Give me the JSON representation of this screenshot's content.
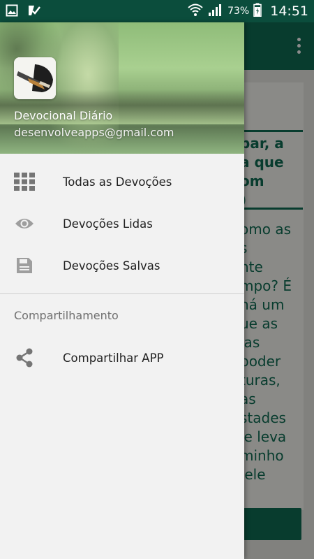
{
  "status_bar": {
    "battery_percent": "73%",
    "time": "14:51",
    "icons": [
      "gallery-icon",
      "check-app-icon",
      "wifi-icon",
      "signal-icon",
      "battery-charging-icon"
    ]
  },
  "background": {
    "title_fragment": "bar, a\na que\nom\n)",
    "body_fragment": "omo as\ns\nnte\nmpo? É\nná um\nue as\nlas\npoder\nturas,\nas\nstades\nle leva\nminho\n ele"
  },
  "drawer": {
    "app_name": "Devocional Diário",
    "email": "desenvolveapps@gmail.com",
    "menu": [
      {
        "label": "Todas as Devoções",
        "icon": "grid-icon"
      },
      {
        "label": "Devoções Lidas",
        "icon": "eye-icon"
      },
      {
        "label": "Devoções Salvas",
        "icon": "save-icon"
      }
    ],
    "section_title": "Compartilhamento",
    "share_item": {
      "label": "Compartilhar APP",
      "icon": "share-icon"
    }
  },
  "colors": {
    "status_bar": "#0b4d3c",
    "primary": "#0f6e55",
    "icon_grey": "#757575"
  }
}
